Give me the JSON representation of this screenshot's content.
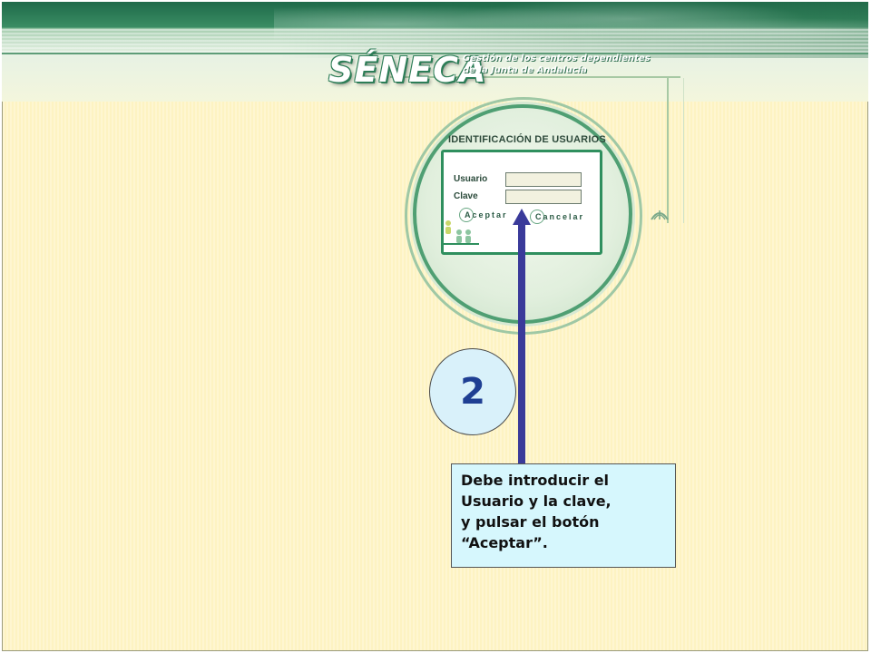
{
  "app": {
    "logo_text": "SÉNECA",
    "subtitle_line1": "Gestión de los centros dependientes",
    "subtitle_line2": "de la Junta de Andalucía"
  },
  "login": {
    "title": "IDENTIFICACIÓN DE USUARIOS",
    "user_label": "Usuario",
    "password_label": "Clave",
    "user_value": "",
    "password_value": "",
    "accept_label": "Aceptar",
    "cancel_label": "Cancelar"
  },
  "annotation": {
    "step_number": "2",
    "lines": [
      "Debe introducir el",
      "Usuario y la clave,",
      "y pulsar el botón",
      "“Aceptar”."
    ]
  },
  "icons": {
    "arrow": "up-arrow-icon",
    "people": "people-icon",
    "emblem": "junta-emblem-icon"
  },
  "colors": {
    "background": "#fdf3c2",
    "brand_green": "#2f8f5e",
    "arrow": "#3a3a9a",
    "step_circle": "#d9f1fa",
    "callout": "#d6f7fd"
  }
}
